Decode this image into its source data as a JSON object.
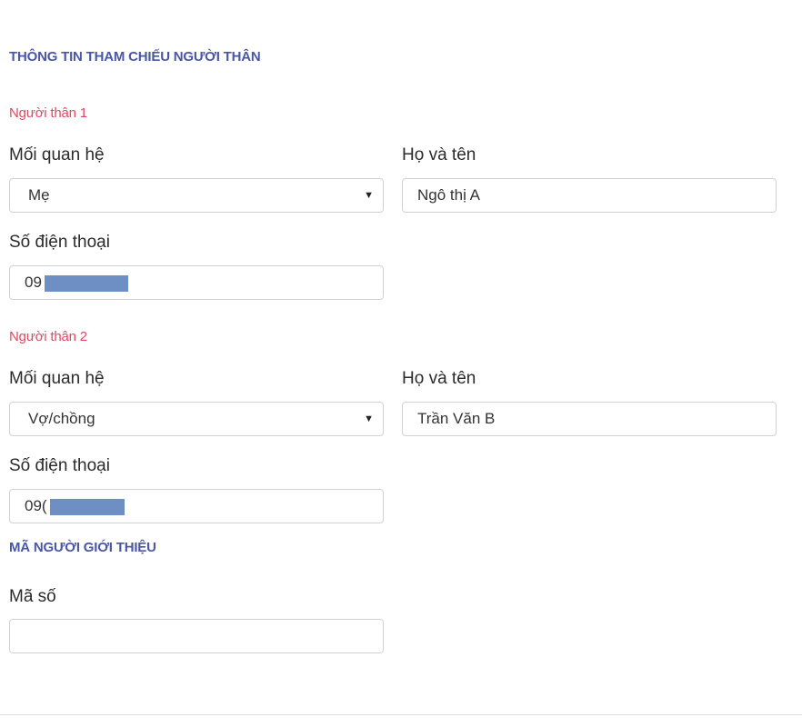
{
  "reference_section": {
    "title": "THÔNG TIN THAM CHIẾU NGƯỜI THÂN"
  },
  "relatives": [
    {
      "heading": "Người thân 1",
      "relationship_label": "Mối quan hệ",
      "relationship_value": "Mẹ",
      "name_label": "Họ và tên",
      "name_value": "Ngô thị A",
      "phone_label": "Số điện thoại",
      "phone_visible_prefix": "09"
    },
    {
      "heading": "Người thân 2",
      "relationship_label": "Mối quan hệ",
      "relationship_value": "Vợ/chồng",
      "name_label": "Họ và tên",
      "name_value": "Trần Văn B",
      "phone_label": "Số điện thoại",
      "phone_visible_prefix": "09("
    }
  ],
  "referrer_section": {
    "title": "MÃ NGƯỜI GIỚI THIỆU",
    "code_label": "Mã số",
    "code_value": ""
  },
  "icons": {
    "select_caret": "dropdown-caret-icon"
  },
  "colors": {
    "section_title": "#4a56a6",
    "relative_heading": "#e2485f",
    "redaction": "#6e8fc4",
    "field_border": "#cfd2d8"
  }
}
